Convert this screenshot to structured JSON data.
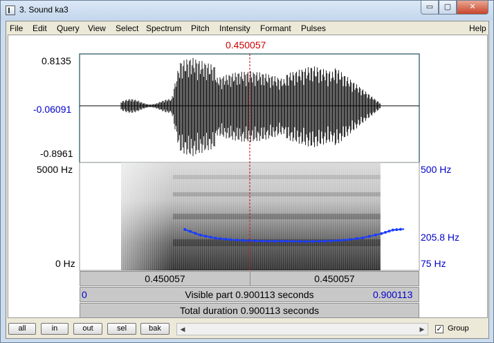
{
  "window": {
    "title": "3. Sound ka3",
    "controls": {
      "minimize": "▭",
      "maximize": "▢",
      "close": "✕"
    }
  },
  "menu": [
    "File",
    "Edit",
    "Query",
    "View",
    "Select",
    "Spectrum",
    "Pitch",
    "Intensity",
    "Formant",
    "Pulses",
    "Help"
  ],
  "cursor": {
    "time": "0.450057"
  },
  "waveform": {
    "ymax": "0.8135",
    "yvalue": "-0.06091",
    "ymin": "-0.8961"
  },
  "spectrogram": {
    "freq_top": "5000 Hz",
    "freq_bottom": "0 Hz",
    "pitch_top": "500 Hz",
    "pitch_value": "205.8 Hz",
    "pitch_bottom": "75 Hz"
  },
  "bars": {
    "left_part": "0.450057",
    "right_part": "0.450057",
    "visible_start": "0",
    "visible_label": "Visible part 0.900113 seconds",
    "visible_end": "0.900113",
    "total_label": "Total duration 0.900113 seconds"
  },
  "buttons": [
    "all",
    "in",
    "out",
    "sel",
    "bak"
  ],
  "group": {
    "label": "Group",
    "checked": "✓"
  },
  "colors": {
    "cursor": "#cc0000",
    "axis_blue": "#0000cc",
    "pitch": "#1a3cff",
    "wave_border": "#1c4f5a"
  },
  "chart_data": {
    "type": "line",
    "x": [
      0.279,
      0.32,
      0.36,
      0.4,
      0.45,
      0.5,
      0.55,
      0.6,
      0.65,
      0.7,
      0.75,
      0.8,
      0.83,
      0.86
    ],
    "values": [
      236,
      214,
      202,
      196,
      192,
      190,
      190,
      189,
      190,
      194,
      203,
      220,
      234,
      238
    ],
    "xlim": [
      0,
      0.900113
    ],
    "ylim": [
      75,
      500
    ]
  }
}
